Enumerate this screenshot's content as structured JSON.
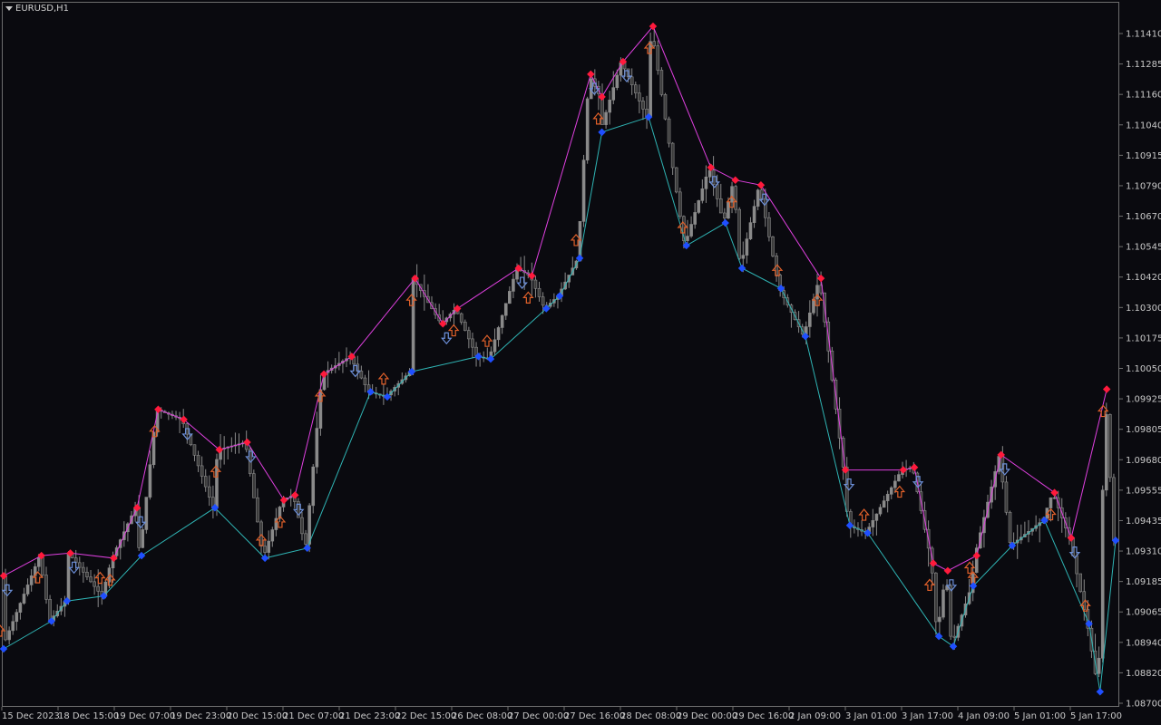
{
  "window": {
    "symbol_title": "EURUSD,H1"
  },
  "colors": {
    "background": "#0a0a0f",
    "frame": "#6e6e6e",
    "candle": "#8a8a8a",
    "candle_dark": "#3c3c3c",
    "zigzag_high": "#e040e0",
    "zigzag_low": "#2fb4b4",
    "high_marker": "#ff1a3c",
    "low_marker": "#1f4fff",
    "arrow_down": "#6c8fd8",
    "arrow_up": "#e0602a"
  },
  "chart_data": {
    "type": "candlestick",
    "symbol": "EURUSD",
    "timeframe": "H1",
    "ylim": [
      1.087,
      1.1149
    ],
    "y_ticks": [
      "1.11410",
      "1.11285",
      "1.11160",
      "1.11040",
      "1.10915",
      "1.10790",
      "1.10670",
      "1.10545",
      "1.10420",
      "1.10300",
      "1.10175",
      "1.10050",
      "1.09925",
      "1.09805",
      "1.09680",
      "1.09555",
      "1.09435",
      "1.09310",
      "1.09185",
      "1.09065",
      "1.08940",
      "1.08820",
      "1.08700"
    ],
    "x_ticks": [
      "15 Dec 2023",
      "18 Dec 15:00",
      "19 Dec 07:00",
      "19 Dec 23:00",
      "20 Dec 15:00",
      "21 Dec 07:00",
      "21 Dec 23:00",
      "22 Dec 15:00",
      "26 Dec 08:00",
      "27 Dec 00:00",
      "27 Dec 16:00",
      "28 Dec 08:00",
      "29 Dec 00:00",
      "29 Dec 16:00",
      "2 Jan 09:00",
      "3 Jan 01:00",
      "3 Jan 17:00",
      "4 Jan 09:00",
      "5 Jan 01:00",
      "5 Jan 17:00"
    ],
    "swing_highs": [
      [
        0.0,
        1.0922
      ],
      [
        0.034,
        1.093
      ],
      [
        0.06,
        1.0931
      ],
      [
        0.099,
        1.0929
      ],
      [
        0.12,
        1.0949
      ],
      [
        0.139,
        1.0988
      ],
      [
        0.162,
        1.0984
      ],
      [
        0.194,
        1.0972
      ],
      [
        0.219,
        1.0975
      ],
      [
        0.252,
        1.0952
      ],
      [
        0.262,
        1.0954
      ],
      [
        0.288,
        1.1002
      ],
      [
        0.313,
        1.1009
      ],
      [
        0.37,
        1.104
      ],
      [
        0.395,
        1.1022
      ],
      [
        0.408,
        1.1028
      ],
      [
        0.463,
        1.1044
      ],
      [
        0.475,
        1.1041
      ],
      [
        0.528,
        1.1121
      ],
      [
        0.538,
        1.1112
      ],
      [
        0.557,
        1.1126
      ],
      [
        0.584,
        1.114
      ],
      [
        0.636,
        1.1084
      ],
      [
        0.658,
        1.1079
      ],
      [
        0.681,
        1.1077
      ],
      [
        0.735,
        1.104
      ],
      [
        0.757,
        1.0964
      ],
      [
        0.809,
        1.0964
      ],
      [
        0.819,
        1.0965
      ],
      [
        0.836,
        1.0927
      ],
      [
        0.849,
        1.0924
      ],
      [
        0.875,
        1.093
      ],
      [
        0.897,
        1.097
      ],
      [
        0.945,
        1.0955
      ],
      [
        0.96,
        1.0937
      ],
      [
        0.992,
        1.0996
      ]
    ],
    "swing_lows": [
      [
        0.0,
        1.0893
      ],
      [
        0.043,
        1.0904
      ],
      [
        0.057,
        1.0912
      ],
      [
        0.09,
        1.0914
      ],
      [
        0.124,
        1.093
      ],
      [
        0.19,
        1.0949
      ],
      [
        0.235,
        1.0929
      ],
      [
        0.273,
        1.0933
      ],
      [
        0.33,
        1.0995
      ],
      [
        0.345,
        1.0993
      ],
      [
        0.367,
        1.1003
      ],
      [
        0.427,
        1.1009
      ],
      [
        0.438,
        1.1008
      ],
      [
        0.488,
        1.1028
      ],
      [
        0.5,
        1.1033
      ],
      [
        0.518,
        1.1048
      ],
      [
        0.538,
        1.1098
      ],
      [
        0.58,
        1.1104
      ],
      [
        0.614,
        1.1053
      ],
      [
        0.649,
        1.1062
      ],
      [
        0.664,
        1.1044
      ],
      [
        0.699,
        1.1036
      ],
      [
        0.721,
        1.1017
      ],
      [
        0.761,
        1.0942
      ],
      [
        0.777,
        1.0939
      ],
      [
        0.841,
        1.0898
      ],
      [
        0.854,
        1.0894
      ],
      [
        0.872,
        1.0918
      ],
      [
        0.907,
        1.0934
      ],
      [
        0.936,
        1.0944
      ],
      [
        0.976,
        1.0903
      ],
      [
        0.986,
        1.0876
      ],
      [
        1.0,
        1.0936
      ]
    ]
  }
}
